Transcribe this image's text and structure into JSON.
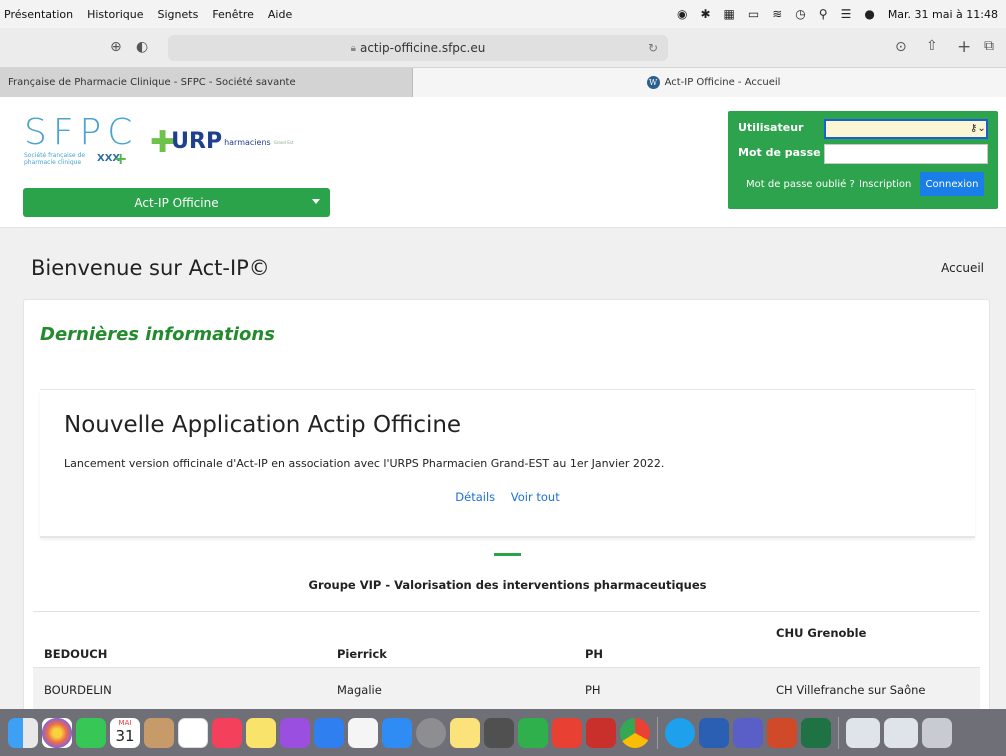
{
  "menubar": {
    "items": [
      "Présentation",
      "Historique",
      "Signets",
      "Fenêtre",
      "Aide"
    ],
    "clock": "Mar. 31 mai à 11:48"
  },
  "browser": {
    "url": "actip-officine.sfpc.eu",
    "tabs": [
      {
        "title": "Française de Pharmacie Clinique - SFPC - Société savante"
      },
      {
        "title": "Act-IP Officine - Accueil"
      }
    ]
  },
  "header": {
    "sfpc_logo_text": "SFPC",
    "sfpc_subtitle": "Société française de pharmacie clinique",
    "urps_logo_text": "URP",
    "urps_sub": "harmaciens",
    "urps_region": "Grand Est",
    "app_select": "Act-IP Officine"
  },
  "login": {
    "user_label": "Utilisateur",
    "password_label": "Mot de passe",
    "user_value": "",
    "password_value": "",
    "forgot_label": "Mot de passe oublié ?",
    "signup_label": "Inscription",
    "connect_label": "Connexion"
  },
  "main": {
    "welcome": "Bienvenue sur Act-IP©",
    "breadcrumb": "Accueil",
    "card_title": "Dernières informations",
    "news": {
      "title": "Nouvelle Application Actip Officine",
      "text": "Lancement version officinale d'Act-IP en association avec l'URPS Pharmacien Grand-EST au 1er Janvier 2022.",
      "details_link": "Détails",
      "all_link": "Voir tout"
    },
    "group_title": "Groupe VIP - Valorisation des interventions pharmaceutiques",
    "members": [
      {
        "last": "BEDOUCH",
        "first": "Pierrick",
        "role": "PH",
        "site": "CHU Grenoble"
      },
      {
        "last": "BOURDELIN",
        "first": "Magalie",
        "role": "PH",
        "site": "CH Villefranche sur Saône"
      }
    ]
  },
  "dock": {
    "apps": [
      "finder-icon",
      "photos-icon",
      "facetime-icon",
      "calendar-icon",
      "contacts-icon",
      "reminders-icon",
      "music-icon",
      "notes-icon",
      "podcasts-icon",
      "keynote-icon",
      "pages-icon",
      "appstore-icon",
      "system-preferences-icon",
      "stickies-icon",
      "calculator-icon",
      "numbers-icon",
      "anydesk-icon",
      "zotero-icon",
      "chrome-icon",
      "skype-icon",
      "word-icon",
      "teams-icon",
      "powerpoint-icon",
      "excel-icon",
      "window-thumb-icon",
      "window-thumb-icon",
      "trash-icon"
    ],
    "calendar_month": "MAI",
    "calendar_day": "31"
  }
}
